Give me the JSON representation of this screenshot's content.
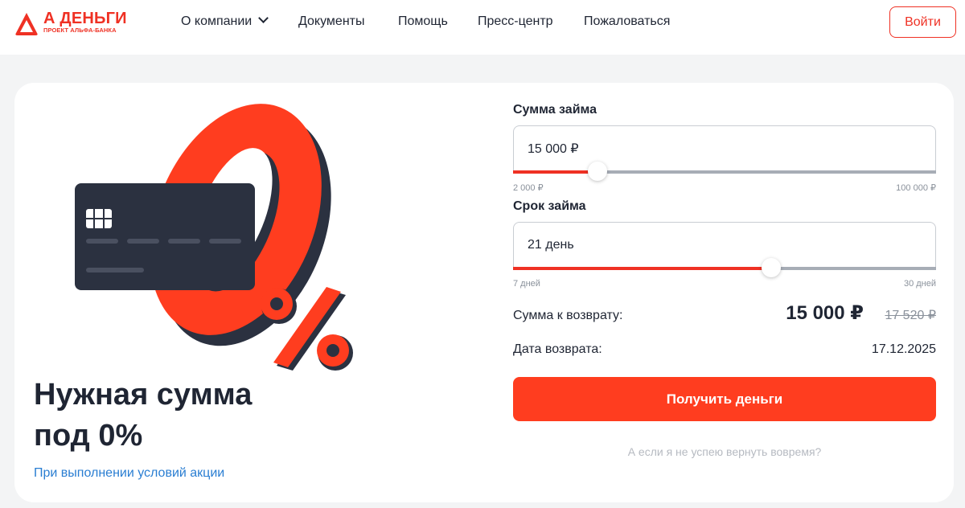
{
  "header": {
    "logo_title": "А ДЕНЬГИ",
    "logo_sub": "ПРОЕКТ АЛЬФА-БАНКА",
    "nav": [
      "О компании",
      "Документы",
      "Помощь",
      "Пресс-центр",
      "Пожаловаться"
    ],
    "login_label": "Войти"
  },
  "hero": {
    "badge_text": "%",
    "title_line1": "Нужная сумма",
    "title_line2": "под 0%",
    "promo_link": "При выполнении условий акции"
  },
  "loan_amount": {
    "label": "Сумма займа",
    "value": "15 000 ₽",
    "min": "2 000 ₽",
    "max": "100 000 ₽",
    "fraction": 0.2
  },
  "loan_term": {
    "label": "Срок займа",
    "value": "21 день",
    "min": "7 дней",
    "max": "30 дней",
    "fraction": 0.61
  },
  "summary": {
    "repay_label": "Сумма к возврату:",
    "repay_amount": "15 000 ₽",
    "repay_old": "17 520 ₽",
    "date_label": "Дата возврата:",
    "date_value": "17.12.2025"
  },
  "cta_label": "Получить деньги",
  "late_link": "А если я не успею вернуть вовремя?",
  "colors": {
    "brand": "#ef3124",
    "cta": "#ff3d1f",
    "text": "#1f2533",
    "link": "#2a7ed2",
    "muted": "#8a919b"
  }
}
